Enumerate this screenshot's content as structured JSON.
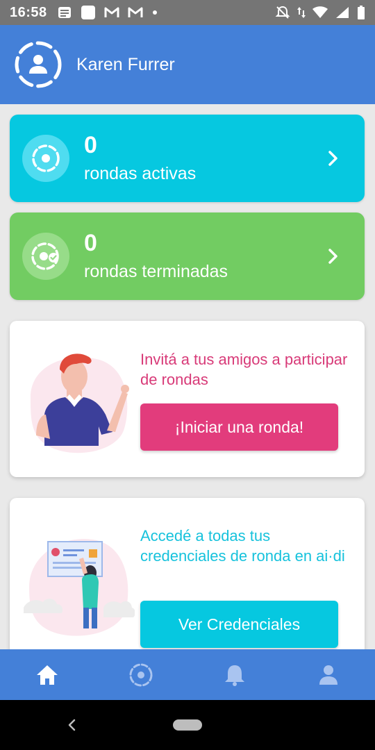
{
  "status_bar": {
    "time": "16:58",
    "left_icons": [
      "notes-icon",
      "square-icon",
      "gmail-icon",
      "gmail-icon",
      "dot-icon"
    ],
    "right_icons": [
      "mute-icon",
      "data-arrows-icon",
      "wifi-icon",
      "signal-icon",
      "battery-icon"
    ]
  },
  "header": {
    "user_name": "Karen Furrer",
    "avatar_icon": "user-ring-icon"
  },
  "stats": {
    "active": {
      "count": "0",
      "label": "rondas activas",
      "icon": "ring-icon",
      "color": "#06c8e0"
    },
    "finished": {
      "count": "0",
      "label": "rondas terminadas",
      "icon": "ring-check-icon",
      "color": "#72cc62"
    }
  },
  "invite_card": {
    "text": "Invitá a tus amigos a participar de rondas",
    "button_label": "¡Iniciar una ronda!",
    "text_color": "#d83a78",
    "button_color": "#e23c7c"
  },
  "credentials_card": {
    "text": "Accedé a todas tus credenciales de ronda en ai·di",
    "button_label": "Ver Credenciales",
    "text_color": "#16c2dc",
    "button_color": "#06c8e0"
  },
  "bottom_nav": {
    "items": [
      "home-icon",
      "ring-icon",
      "bell-icon",
      "person-icon"
    ],
    "active": "home-icon",
    "background": "#4480d8"
  },
  "system_nav": {
    "items": [
      "back-icon",
      "home-pill"
    ]
  }
}
